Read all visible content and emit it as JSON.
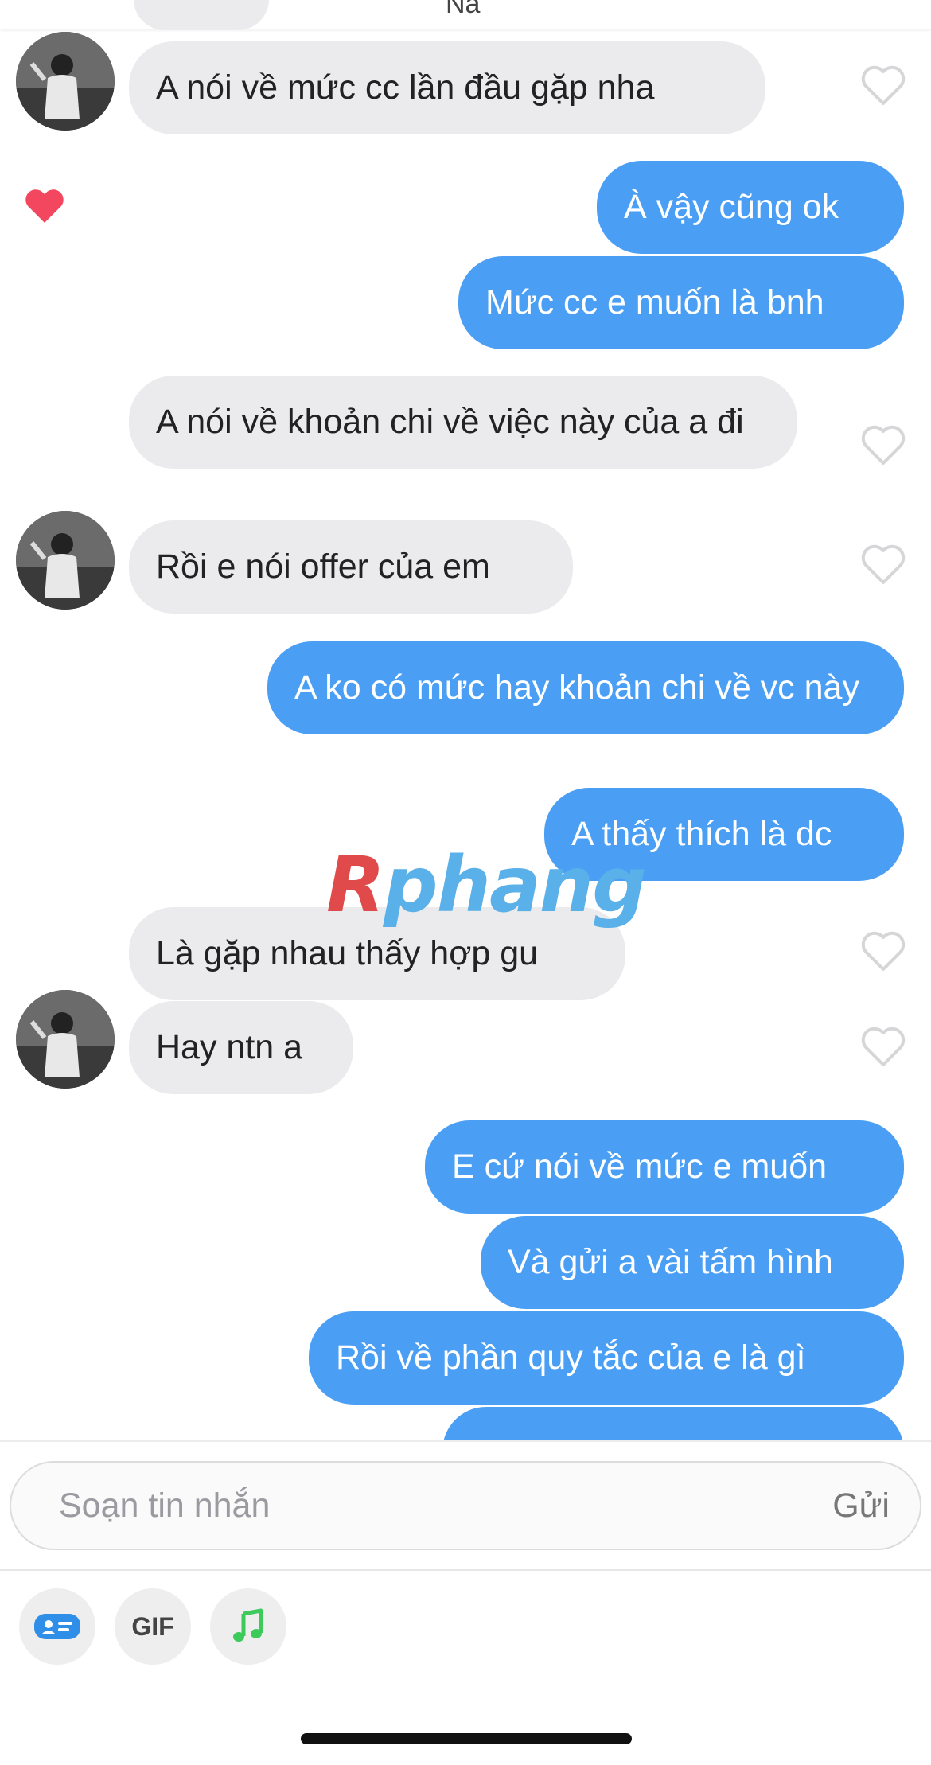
{
  "header": {
    "contact_name": "Na"
  },
  "messages": [
    {
      "id": 1,
      "direction": "in",
      "text": "A nói về mức cc lần đầu gặp nha"
    },
    {
      "id": 2,
      "direction": "out",
      "text": "À vậy cũng ok",
      "liked": true
    },
    {
      "id": 3,
      "direction": "out",
      "text": "Mức cc e muốn là bnh"
    },
    {
      "id": 4,
      "direction": "in",
      "text": "A nói về khoản chi về việc này của a đi"
    },
    {
      "id": 5,
      "direction": "in",
      "text": "Rồi e nói offer của em"
    },
    {
      "id": 6,
      "direction": "out",
      "text": "A ko có mức hay khoản chi về vc này"
    },
    {
      "id": 7,
      "direction": "out",
      "text": "A thấy thích là dc"
    },
    {
      "id": 8,
      "direction": "in",
      "text": "Là gặp nhau thấy hợp gu"
    },
    {
      "id": 9,
      "direction": "in",
      "text": "Hay ntn a"
    },
    {
      "id": 10,
      "direction": "out",
      "text": "E cứ nói về mức e muốn"
    },
    {
      "id": 11,
      "direction": "out",
      "text": "Và gửi a vài tấm hình"
    },
    {
      "id": 12,
      "direction": "out",
      "text": "Rồi về phần quy tắc của e là gì"
    }
  ],
  "watermark": {
    "first": "R",
    "rest": "phang"
  },
  "composer": {
    "placeholder": "Soạn tin nhắn",
    "send_label": "Gửi"
  },
  "toolbar": {
    "gif_label": "GIF"
  },
  "colors": {
    "outgoing": "#4a9ff5",
    "incoming": "#ebebed",
    "like": "#f2475f",
    "music": "#3ccb5a",
    "card": "#2f8ee8"
  }
}
